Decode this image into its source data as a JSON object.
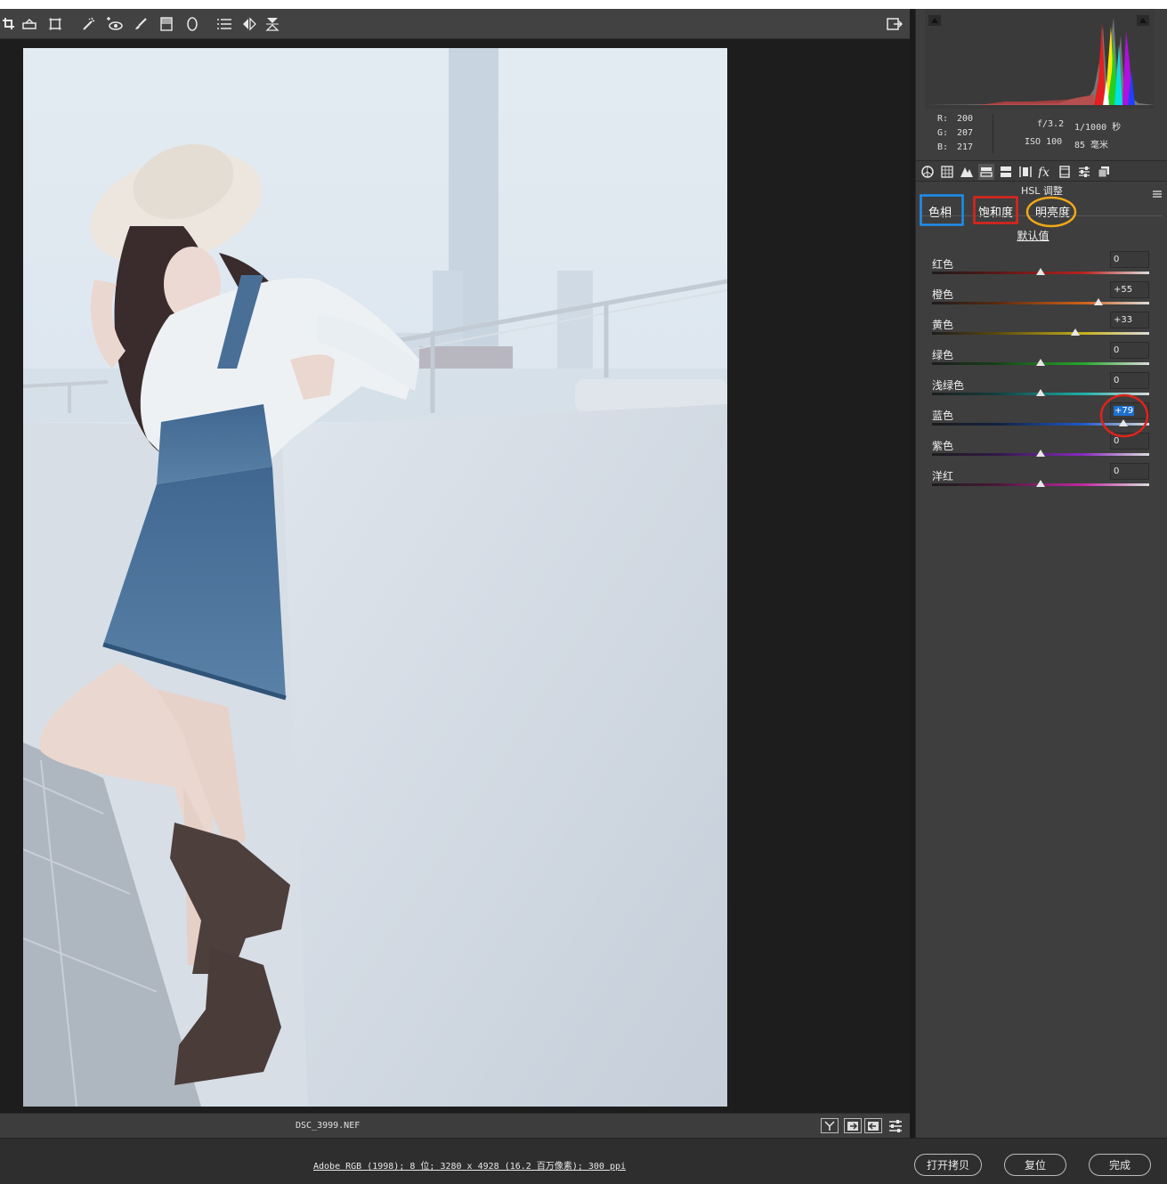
{
  "toolbar": {
    "tools": [
      "crop-icon",
      "straighten-icon",
      "transform-icon",
      "spot-removal-icon",
      "red-eye-icon",
      "adjustment-brush-icon",
      "graduated-filter-icon",
      "radial-filter-icon",
      "presets-list-icon",
      "rotate-icon",
      "flip-icon"
    ],
    "open_prefs_icon": "export-icon"
  },
  "histogram": {
    "r_label": "R:",
    "r_value": "200",
    "g_label": "G:",
    "g_value": "207",
    "b_label": "B:",
    "b_value": "217",
    "aperture": "f/3.2",
    "shutter": "1/1000 秒",
    "iso": "ISO 100",
    "focal": "85 毫米"
  },
  "panel": {
    "title": "HSL 调整",
    "tabs": [
      {
        "label": "色相",
        "highlight": "#1e8ff0"
      },
      {
        "label": "饱和度",
        "highlight": "#e0231c"
      },
      {
        "label": "明亮度",
        "highlight": "#f0a818"
      }
    ],
    "default_link": "默认值",
    "sliders": [
      {
        "label": "红色",
        "value": "0",
        "numeric": 0,
        "gradient": [
          "#5a1818",
          "#b8231f"
        ]
      },
      {
        "label": "橙色",
        "value": "+55",
        "numeric": 55,
        "gradient": [
          "#5a2a10",
          "#d06018"
        ]
      },
      {
        "label": "黄色",
        "value": "+33",
        "numeric": 33,
        "gradient": [
          "#5a4a10",
          "#c8b018"
        ]
      },
      {
        "label": "绿色",
        "value": "0",
        "numeric": 0,
        "gradient": [
          "#18401a",
          "#27a82a"
        ]
      },
      {
        "label": "浅绿色",
        "value": "0",
        "numeric": 0,
        "gradient": [
          "#124040",
          "#1eb0a8"
        ]
      },
      {
        "label": "蓝色",
        "value": "+79",
        "numeric": 79,
        "gradient": [
          "#122040",
          "#1e5ac8"
        ],
        "selected": true
      },
      {
        "label": "紫色",
        "value": "0",
        "numeric": 0,
        "gradient": [
          "#301848",
          "#8a2ac0"
        ]
      },
      {
        "label": "洋红",
        "value": "0",
        "numeric": 0,
        "gradient": [
          "#481838",
          "#c02aa0"
        ]
      }
    ]
  },
  "filmbar": {
    "filename": "DSC_3999.NEF"
  },
  "footer": {
    "workflow_link": "Adobe RGB (1998); 8 位; 3280 x 4928 (16.2 百万像素); 300 ppi",
    "open_copy_button": "打开拷贝",
    "reset_button": "复位",
    "done_button": "完成"
  }
}
